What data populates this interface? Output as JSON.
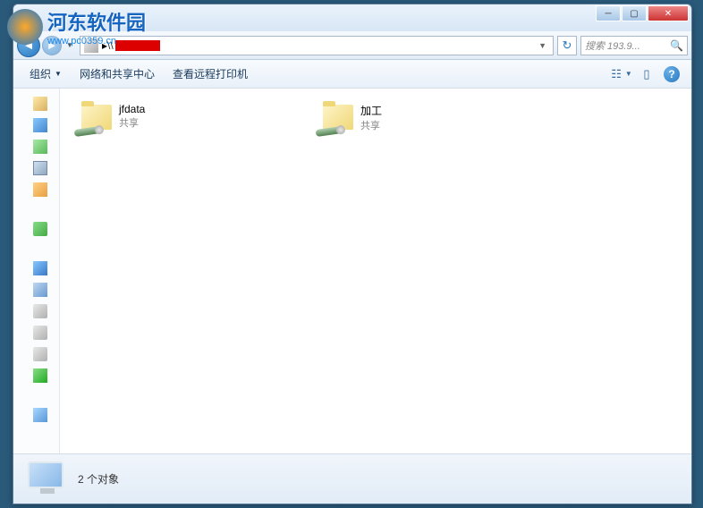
{
  "watermark": {
    "title": "河东软件园",
    "url": "www.pc0359.cn"
  },
  "address": {
    "prefix": "▸",
    "network_prefix": "\\\\"
  },
  "search": {
    "placeholder": "搜索 193.9..."
  },
  "toolbar": {
    "organize": "组织",
    "network_center": "网络和共享中心",
    "view_printers": "查看远程打印机"
  },
  "folders": [
    {
      "name": "jfdata",
      "sub": "共享"
    },
    {
      "name": "加工",
      "sub": "共享"
    }
  ],
  "status": {
    "count_text": "2 个对象"
  }
}
